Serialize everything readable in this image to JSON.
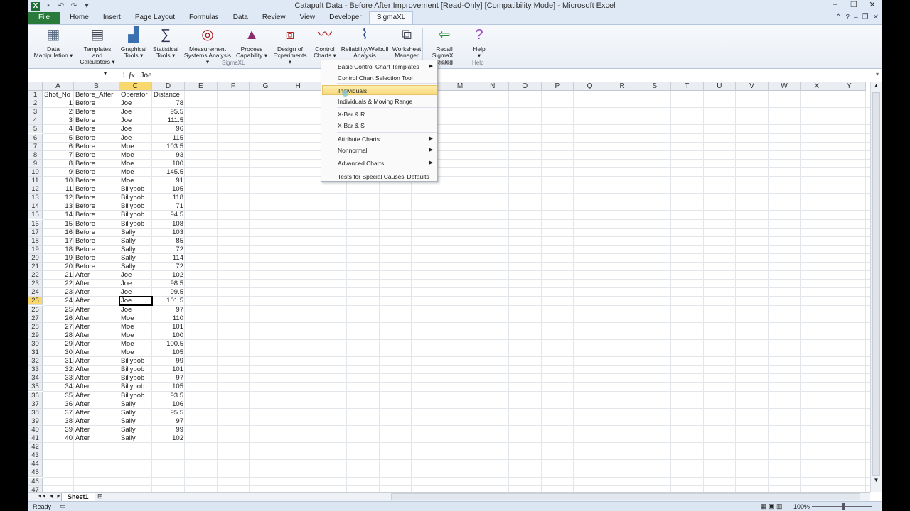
{
  "window": {
    "title": "Catapult Data - Before After Improvement  [Read-Only]  [Compatibility Mode] - Microsoft Excel"
  },
  "tabs": [
    "File",
    "Home",
    "Insert",
    "Page Layout",
    "Formulas",
    "Data",
    "Review",
    "View",
    "Developer",
    "SigmaXL"
  ],
  "active_tab": "SigmaXL",
  "ribbon": {
    "buttons": [
      {
        "line1": "Data",
        "line2": "Manipulation ▾"
      },
      {
        "line1": "Templates and",
        "line2": "Calculators ▾"
      },
      {
        "line1": "Graphical",
        "line2": "Tools ▾"
      },
      {
        "line1": "Statistical",
        "line2": "Tools ▾"
      },
      {
        "line1": "Measurement",
        "line2": "Systems Analysis ▾"
      },
      {
        "line1": "Process",
        "line2": "Capability ▾"
      },
      {
        "line1": "Design of",
        "line2": "Experiments ▾"
      },
      {
        "line1": "Control",
        "line2": "Charts ▾"
      },
      {
        "line1": "Reliability/Weibull",
        "line2": "Analysis"
      },
      {
        "line1": "Worksheet",
        "line2": "Manager"
      },
      {
        "line1": "Recall SigmaXL",
        "line2": "Dialog"
      },
      {
        "line1": "Help",
        "line2": "▾"
      }
    ],
    "groups": [
      "SigmaXL",
      "Recall",
      "Help"
    ]
  },
  "formula_bar": {
    "name_box": "",
    "fx": "fx",
    "value": "Joe"
  },
  "columns": [
    "A",
    "B",
    "C",
    "D",
    "E",
    "F",
    "G",
    "H",
    "I",
    "J",
    "K",
    "L",
    "M",
    "N",
    "O",
    "P",
    "Q",
    "R",
    "S",
    "T",
    "U",
    "V",
    "W",
    "X",
    "Y"
  ],
  "headers": [
    "Shot_No",
    "Before_After",
    "Operator",
    "Distance"
  ],
  "rows": [
    [
      1,
      "Before",
      "Joe",
      "78"
    ],
    [
      2,
      "Before",
      "Joe",
      "95.5"
    ],
    [
      3,
      "Before",
      "Joe",
      "111.5"
    ],
    [
      4,
      "Before",
      "Joe",
      "96"
    ],
    [
      5,
      "Before",
      "Joe",
      "115"
    ],
    [
      6,
      "Before",
      "Moe",
      "103.5"
    ],
    [
      7,
      "Before",
      "Moe",
      "93"
    ],
    [
      8,
      "Before",
      "Moe",
      "100"
    ],
    [
      9,
      "Before",
      "Moe",
      "145.5"
    ],
    [
      10,
      "Before",
      "Moe",
      "91"
    ],
    [
      11,
      "Before",
      "Billybob",
      "105"
    ],
    [
      12,
      "Before",
      "Billybob",
      "118"
    ],
    [
      13,
      "Before",
      "Billybob",
      "71"
    ],
    [
      14,
      "Before",
      "Billybob",
      "94.5"
    ],
    [
      15,
      "Before",
      "Billybob",
      "108"
    ],
    [
      16,
      "Before",
      "Sally",
      "103"
    ],
    [
      17,
      "Before",
      "Sally",
      "85"
    ],
    [
      18,
      "Before",
      "Sally",
      "72"
    ],
    [
      19,
      "Before",
      "Sally",
      "114"
    ],
    [
      20,
      "Before",
      "Sally",
      "72"
    ],
    [
      21,
      "After",
      "Joe",
      "102"
    ],
    [
      22,
      "After",
      "Joe",
      "98.5"
    ],
    [
      23,
      "After",
      "Joe",
      "99.5"
    ],
    [
      24,
      "After",
      "Joe",
      "101.5"
    ],
    [
      25,
      "After",
      "Joe",
      "97"
    ],
    [
      26,
      "After",
      "Moe",
      "110"
    ],
    [
      27,
      "After",
      "Moe",
      "101"
    ],
    [
      28,
      "After",
      "Moe",
      "100"
    ],
    [
      29,
      "After",
      "Moe",
      "100.5"
    ],
    [
      30,
      "After",
      "Moe",
      "105"
    ],
    [
      31,
      "After",
      "Billybob",
      "99"
    ],
    [
      32,
      "After",
      "Billybob",
      "101"
    ],
    [
      33,
      "After",
      "Billybob",
      "97"
    ],
    [
      34,
      "After",
      "Billybob",
      "105"
    ],
    [
      35,
      "After",
      "Billybob",
      "93.5"
    ],
    [
      36,
      "After",
      "Sally",
      "106"
    ],
    [
      37,
      "After",
      "Sally",
      "95.5"
    ],
    [
      38,
      "After",
      "Sally",
      "97"
    ],
    [
      39,
      "After",
      "Sally",
      "99"
    ],
    [
      40,
      "After",
      "Sally",
      "102"
    ]
  ],
  "total_row_headers": 47,
  "selected": {
    "row": 25,
    "col": "C"
  },
  "menu": {
    "items": [
      {
        "label": "Basic Control Chart Templates",
        "submenu": true
      },
      {
        "label": "Control Chart Selection Tool",
        "submenu": false
      },
      {
        "label": "Individuals",
        "submenu": false,
        "highlighted": true
      },
      {
        "label": "Individuals & Moving Range",
        "submenu": false
      },
      {
        "label": "X-Bar & R",
        "submenu": false
      },
      {
        "label": "X-Bar & S",
        "submenu": false
      },
      {
        "label": "Attribute Charts",
        "submenu": true
      },
      {
        "label": "Nonnormal",
        "submenu": true
      },
      {
        "label": "Advanced Charts",
        "submenu": true
      },
      {
        "label": "Tests for Special Causes' Defaults",
        "submenu": false
      }
    ]
  },
  "sheet_tab": "Sheet1",
  "status": {
    "ready": "Ready",
    "zoom": "100%"
  },
  "colors": {
    "file_tab": "#2a7b3b",
    "highlight": "#f9d96e"
  }
}
